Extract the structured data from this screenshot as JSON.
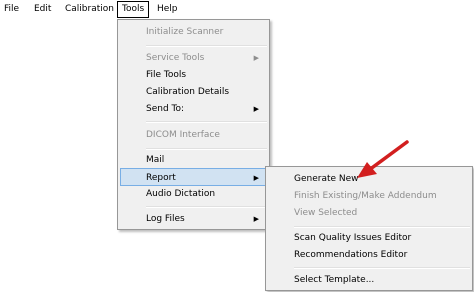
{
  "menubar": {
    "items": [
      {
        "label": "File"
      },
      {
        "label": "Edit"
      },
      {
        "label": "Calibration"
      },
      {
        "label": "Tools"
      },
      {
        "label": "Help"
      }
    ]
  },
  "tools_menu": {
    "items": [
      {
        "label": "Initialize Scanner"
      },
      {
        "label": "Service Tools"
      },
      {
        "label": "File Tools"
      },
      {
        "label": "Calibration Details"
      },
      {
        "label": "Send To:"
      },
      {
        "label": "DICOM Interface"
      },
      {
        "label": "Mail"
      },
      {
        "label": "Report"
      },
      {
        "label": "Audio Dictation"
      },
      {
        "label": "Log Files"
      }
    ]
  },
  "report_submenu": {
    "items": [
      {
        "label": "Generate New"
      },
      {
        "label": "Finish Existing/Make Addendum"
      },
      {
        "label": "View Selected"
      },
      {
        "label": "Scan Quality Issues Editor"
      },
      {
        "label": "Recommendations Editor"
      },
      {
        "label": "Select Template..."
      }
    ]
  },
  "icons": {
    "submenu_arrow": "▶",
    "annotation": "red-arrow-pointer"
  },
  "colors": {
    "highlight_bg": "#d1e2f2",
    "highlight_border": "#78aee5",
    "annotation_red": "#d21f1f"
  }
}
